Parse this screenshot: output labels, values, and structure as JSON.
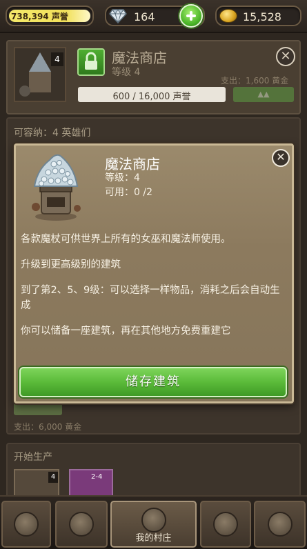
{
  "topbar": {
    "reputation": "738,394 声誉",
    "gems": "164",
    "gold": "15,528"
  },
  "background_building": {
    "badge": "4",
    "title": "魔法商店",
    "level": "等级 4",
    "cost": "支出：1,600 黄金",
    "progress_text": "600 / 16,000 声誉",
    "progress_fraction": 0.0375
  },
  "capacity": "可容纳：4 英雄们",
  "cost2": "支出：6,000 黄金",
  "production": {
    "title": "开始生产",
    "card1_badge": "4",
    "card2_badge": "2-4"
  },
  "dialog": {
    "title": "魔法商店",
    "level": "等级：4",
    "available": "可用：0 /2",
    "desc1": "各款魔杖可供世界上所有的女巫和魔法师使用。",
    "desc2": "升级到更高级别的建筑",
    "desc3": "到了第2、5、9级：可以选择一样物品，消耗之后会自动生成",
    "desc4": "你可以储备一座建筑，再在其他地方免费重建它",
    "store_button": "储存建筑"
  },
  "nav": {
    "village_label": "我的村庄"
  },
  "colors": {
    "accent_green": "#5bbb3a",
    "reputation_yellow": "#f1e05a",
    "dialog_bg": "#8c7a5e"
  }
}
